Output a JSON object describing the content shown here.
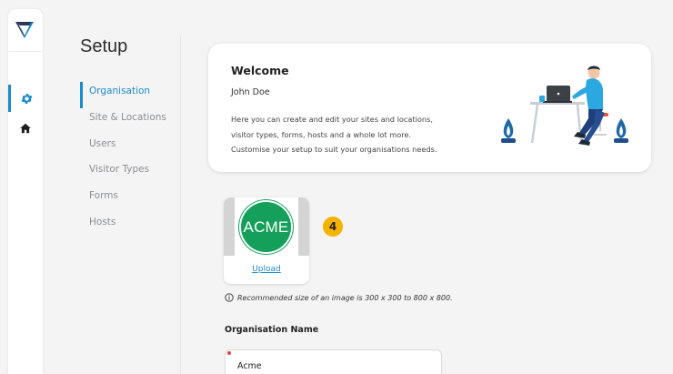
{
  "app": {
    "rail": {
      "items": [
        {
          "icon": "gear-icon",
          "active": true
        },
        {
          "icon": "home-icon",
          "active": false
        }
      ]
    }
  },
  "setup": {
    "title": "Setup",
    "menu": [
      {
        "label": "Organisation",
        "active": true
      },
      {
        "label": "Site & Locations",
        "active": false
      },
      {
        "label": "Users",
        "active": false
      },
      {
        "label": "Visitor Types",
        "active": false
      },
      {
        "label": "Forms",
        "active": false
      },
      {
        "label": "Hosts",
        "active": false
      }
    ]
  },
  "welcome": {
    "title": "Welcome",
    "user": "John Doe",
    "lines": [
      "Here you can create and edit your sites and locations,",
      "visitor types, forms, hosts and a whole lot more.",
      "Customise your setup to suit your organisations needs."
    ]
  },
  "logo": {
    "text": "ACME",
    "upload_label": "Upload",
    "step_number": "4",
    "hint": "Recommended size of an image is 300 x 300 to 800 x 800."
  },
  "organisation_name": {
    "label": "Organisation Name",
    "value": "Acme"
  },
  "colors": {
    "accent": "#1a8ccb",
    "logo_green": "#14a05a",
    "badge": "#f5b300",
    "required": "#e04848"
  }
}
